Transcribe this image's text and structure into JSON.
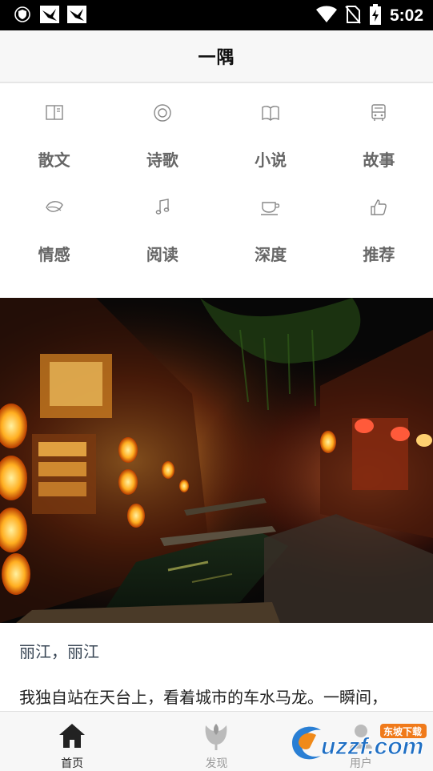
{
  "status_bar": {
    "time": "5:02",
    "icons": [
      "shield-icon",
      "bird-notification-icon",
      "bird-notification-icon",
      "wifi-icon",
      "no-sim-icon",
      "battery-charging-icon"
    ]
  },
  "app_bar": {
    "title": "一隅"
  },
  "categories": [
    {
      "label": "散文",
      "icon": "book-icon"
    },
    {
      "label": "诗歌",
      "icon": "circle-icon"
    },
    {
      "label": "小说",
      "icon": "open-book-icon"
    },
    {
      "label": "故事",
      "icon": "bus-icon"
    },
    {
      "label": "情感",
      "icon": "leaf-icon"
    },
    {
      "label": "阅读",
      "icon": "music-note-icon"
    },
    {
      "label": "深度",
      "icon": "cup-icon"
    },
    {
      "label": "推荐",
      "icon": "thumbs-up-icon"
    }
  ],
  "article": {
    "title": "丽江，丽江",
    "excerpt": "我独自站在天台上，看着城市的车水马龙。一瞬间，",
    "image": "night-street-canal-photo"
  },
  "bottom_nav": [
    {
      "label": "首页",
      "icon": "home-icon",
      "active": true
    },
    {
      "label": "发现",
      "icon": "tulip-icon",
      "active": false
    },
    {
      "label": "用户",
      "icon": "user-icon",
      "active": false
    }
  ],
  "watermark": {
    "text": "uzzf.com",
    "subtext": "东坡下载"
  },
  "colors": {
    "accent_text": "#3a4756",
    "category_label": "#666666",
    "nav_inactive": "#999999"
  }
}
